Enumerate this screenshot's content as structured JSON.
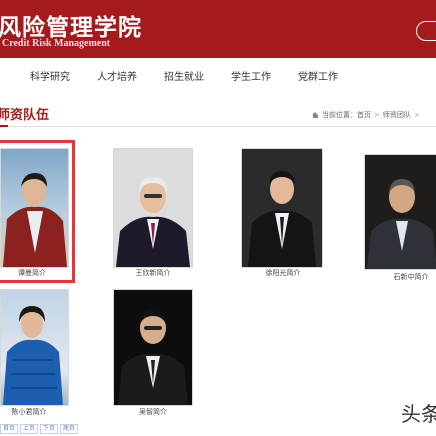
{
  "header": {
    "title": "风险管理学院",
    "subtitle": "Credit Risk Management"
  },
  "nav": {
    "items": [
      {
        "label": "科学研究"
      },
      {
        "label": "人才培养"
      },
      {
        "label": "招生就业"
      },
      {
        "label": "学生工作"
      },
      {
        "label": "党群工作"
      }
    ]
  },
  "section": {
    "title": "师资队伍"
  },
  "breadcrumb": {
    "prefix": "当前位置：",
    "items": [
      "首页",
      "师资团队"
    ],
    "trailing": ">"
  },
  "faculty": [
    {
      "caption": "谭曼简介",
      "selected": true
    },
    {
      "caption": "王欣新简介",
      "selected": false
    },
    {
      "caption": "徐阳光简介",
      "selected": false
    },
    {
      "caption": "石新中简介",
      "selected": false
    },
    {
      "caption": "陈小君简介",
      "selected": false
    },
    {
      "caption": "吴智简介",
      "selected": false
    }
  ],
  "pager": {
    "items": [
      "首页",
      "上页",
      "下页",
      "尾页"
    ]
  },
  "watermark": "头条",
  "colors": {
    "brand": "#a51b1d",
    "highlight": "#e0383b"
  }
}
